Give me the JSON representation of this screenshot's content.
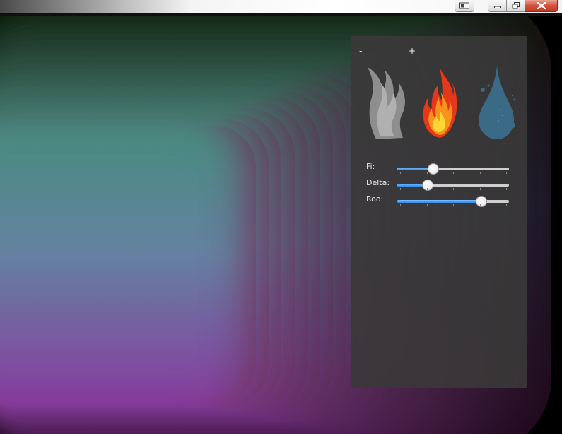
{
  "window": {
    "controls": [
      "extra-button",
      "minimize",
      "maximize",
      "close"
    ]
  },
  "toolbar": {
    "zoom_out_label": "-",
    "zoom_in_label": "+"
  },
  "elements": [
    {
      "name": "smoke",
      "icon": "smoke-icon",
      "color": "#9a9a9a"
    },
    {
      "name": "fire",
      "icon": "fire-icon",
      "color": "#e8401c"
    },
    {
      "name": "water",
      "icon": "water-drop-icon",
      "color": "#3d6e8a"
    }
  ],
  "sliders": [
    {
      "label": "Fi:",
      "value": 0.32
    },
    {
      "label": "Delta:",
      "value": 0.27
    },
    {
      "label": "Roo:",
      "value": 0.75
    }
  ],
  "slider_ticks": 5,
  "colors": {
    "panel_background": "#3a3838",
    "slider_fill": "#2f86e8",
    "close_button": "#c0392b"
  }
}
